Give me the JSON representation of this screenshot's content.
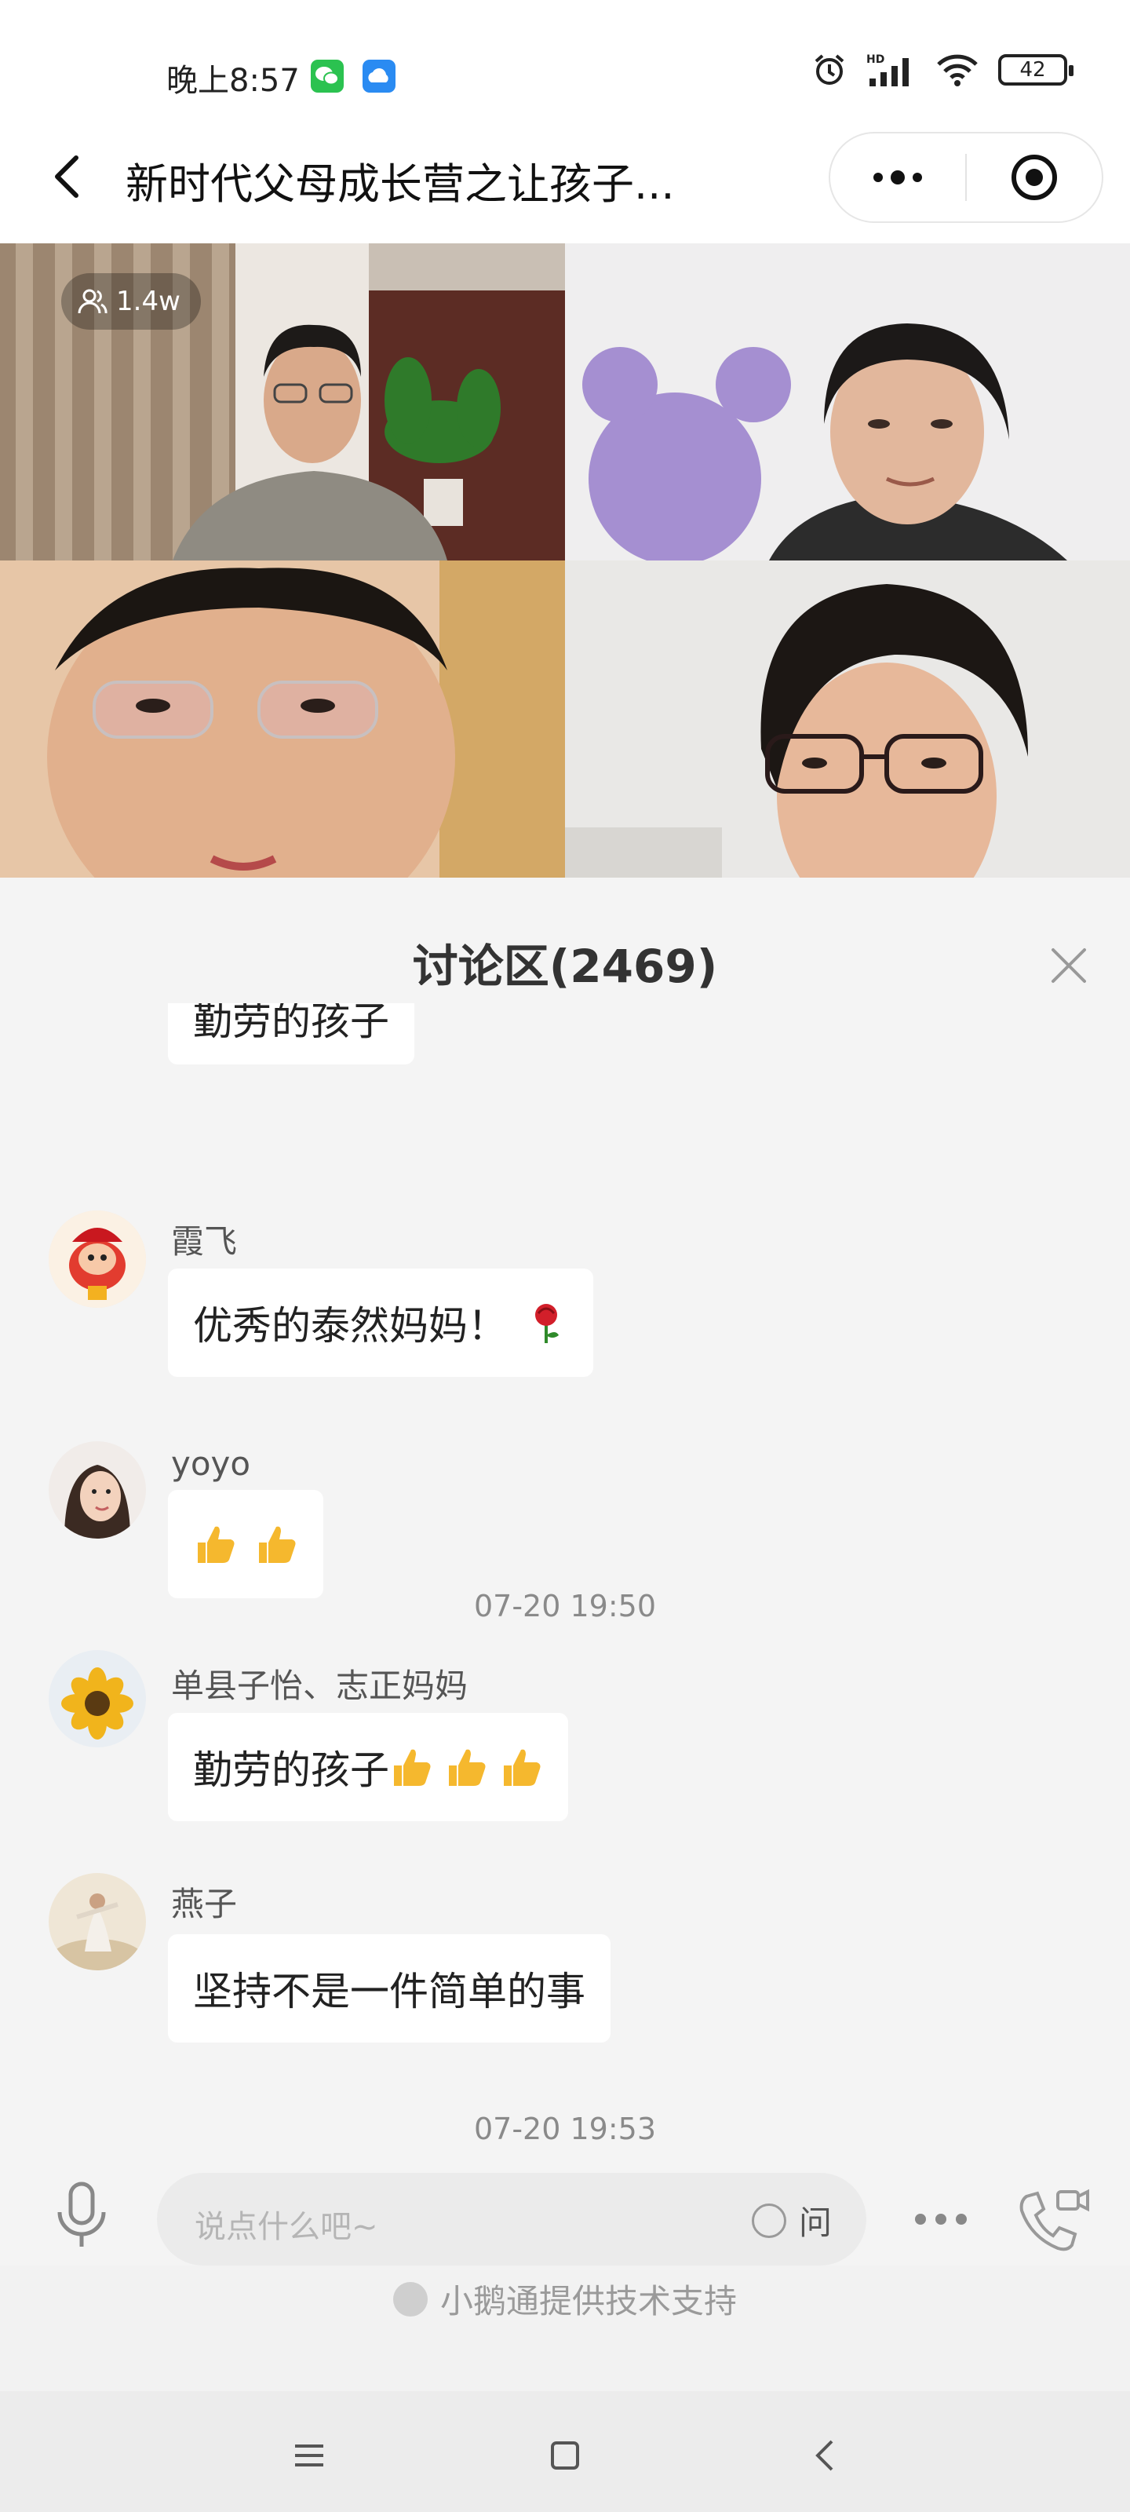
{
  "status_bar": {
    "time": "晚上8:57",
    "battery": "42",
    "icons": [
      "wechat-icon",
      "cloud-icon",
      "alarm-icon",
      "hd-signal-icon",
      "wifi-icon",
      "battery-icon"
    ]
  },
  "nav": {
    "title": "新时代父母成长营之让孩子...",
    "back_icon": "chevron-left-icon",
    "menu_icon": "more-dots-icon",
    "close_icon": "target-circle-icon"
  },
  "live": {
    "viewer_count": "1.4w"
  },
  "discussion": {
    "title": "讨论区(2469)",
    "close_icon": "close-x-icon",
    "messages": [
      {
        "type": "message",
        "sender": "",
        "text": "勤劳的孩子",
        "partial": true
      },
      {
        "type": "message",
        "sender": "霞飞",
        "text": "优秀的泰然妈妈！",
        "emoji": "rose-icon"
      },
      {
        "type": "message",
        "sender": "yoyo",
        "text": "",
        "emoji": "thumbs-up-icon x2"
      },
      {
        "type": "timestamp",
        "text": "07-20 19:50"
      },
      {
        "type": "message",
        "sender": "单县子怡、志正妈妈",
        "text": "勤劳的孩子",
        "emoji": "thumbs-up-icon x3"
      },
      {
        "type": "message",
        "sender": "燕子",
        "text": "坚持不是一件简单的事"
      },
      {
        "type": "timestamp",
        "text": "07-20 19:53"
      }
    ]
  },
  "input": {
    "placeholder": "说点什么吧~",
    "ask_label": "问"
  },
  "footer": {
    "support_text": "小鹅通提供技术支持"
  },
  "colors": {
    "background": "#f4f4f4",
    "bubble": "#ffffff",
    "thumb": "#f5b82e",
    "rose": "#d21f2a"
  }
}
